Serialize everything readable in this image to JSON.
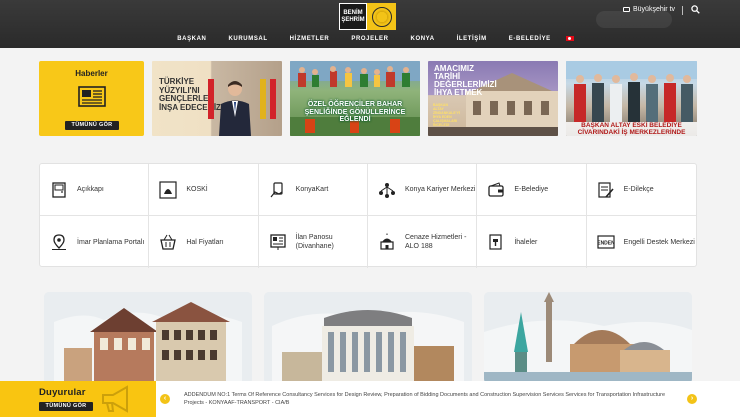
{
  "header": {
    "logo_text": "BENİM ŞEHRİM",
    "seal_text": "KONYA BÜYÜKŞEHİR BELEDİYESİ",
    "tv_label": "Büyükşehir tv",
    "nav": [
      "BAŞKAN",
      "KURUMSAL",
      "HİZMETLER",
      "PROJELER",
      "KONYA",
      "İLETİŞİM",
      "E-BELEDİYE"
    ]
  },
  "news": {
    "title": "Haberler",
    "button": "TÜMÜNÜ GÖR",
    "items": [
      {
        "caption": "TÜRKİYE YÜZYILI'NI GENÇLERLE İNŞA EDECEĞİZ"
      },
      {
        "caption": "ÖZEL ÖĞRENCİLER BAHAR ŞENLİĞİNDE GÖNÜLLERİNCE EĞLENDİ"
      },
      {
        "caption": "AMACIMIZ TARİHİ DEĞERLERİMİZİ İHYA ETMEK",
        "sub": "BAŞKAN ALTAY ZİNDANKALE'Yİ İHYA EDEN ÇALIŞMALARI İNCELEDİ"
      },
      {
        "caption": "BAŞKAN ALTAY ESKİ BELEDİYE CİVARINDAKİ İŞ MERKEZLERİNDE ESNAFLARLA BULUŞTU"
      }
    ]
  },
  "services": [
    {
      "label": "Açıkkapı",
      "icon": "door-icon"
    },
    {
      "label": "KOSKİ",
      "icon": "koski-logo-icon"
    },
    {
      "label": "KonyaKart",
      "icon": "hand-card-icon"
    },
    {
      "label": "Konya Kariyer Merkezi",
      "icon": "people-network-icon"
    },
    {
      "label": "E-Belediye",
      "icon": "wallet-icon"
    },
    {
      "label": "E-Dilekçe",
      "icon": "document-pen-icon"
    },
    {
      "label": "İmar Planlama Portalı",
      "icon": "map-pin-icon"
    },
    {
      "label": "Hal Fiyatları",
      "icon": "basket-icon"
    },
    {
      "label": "İlan Panosu (Divanhane)",
      "icon": "notice-board-icon"
    },
    {
      "label": "Cenaze Hizmetleri - ALO 188",
      "icon": "mosque-icon"
    },
    {
      "label": "İhaleler",
      "icon": "gavel-doc-icon"
    },
    {
      "label": "Engelli Destek Merkezi",
      "icon": "enden-logo-icon"
    }
  ],
  "landmarks": [
    "historic-mansion",
    "government-building",
    "mevlana-mosque"
  ],
  "announcements": {
    "title": "Duyurular",
    "button": "TÜMÜNÜ GÖR",
    "text": "ADDENDUM NO:1 Terms Of Reference Consultancy Services for Design Review, Preparation of Bidding Documents and Construction Supervision Services Services for Transportation Infrastructure Projects - KONYAAF-TRANSPORT - CIA/B"
  },
  "colors": {
    "brand_yellow": "#f8c818",
    "header_dark": "#2f2f2f",
    "dark_button": "#222222"
  }
}
